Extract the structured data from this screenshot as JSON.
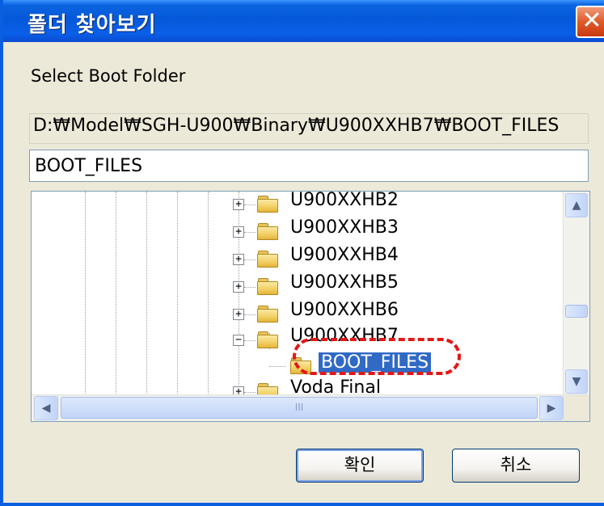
{
  "window": {
    "title": "폴더 찾아보기",
    "close_glyph": "✕"
  },
  "dialog": {
    "prompt": "Select Boot Folder",
    "current_path": "D:₩Model₩SGH-U900₩Binary₩U900XXHB7₩BOOT_FILES",
    "folder_name_value": "BOOT_FILES"
  },
  "tree": {
    "items": [
      {
        "label": "U900XXHB2",
        "expander": "+",
        "depth": 1
      },
      {
        "label": "U900XXHB3",
        "expander": "+",
        "depth": 1
      },
      {
        "label": "U900XXHB4",
        "expander": "+",
        "depth": 1
      },
      {
        "label": "U900XXHB5",
        "expander": "+",
        "depth": 1
      },
      {
        "label": "U900XXHB6",
        "expander": "+",
        "depth": 1
      },
      {
        "label": "U900XXHB7",
        "expander": "−",
        "depth": 1
      },
      {
        "label": "BOOT_FILES",
        "expander": "",
        "depth": 2,
        "selected": true
      },
      {
        "label": "Voda Final",
        "expander": "+",
        "depth": 1
      }
    ]
  },
  "scrollbars": {
    "up_glyph": "▲",
    "down_glyph": "▼",
    "left_glyph": "◀",
    "right_glyph": "▶",
    "h_grip": "III"
  },
  "buttons": {
    "ok_label": "확인",
    "cancel_label": "취소"
  },
  "colors": {
    "title_bar": "#0a5fe0",
    "selection": "#316ac5",
    "annotation": "#e21818"
  },
  "icons": [
    "close-icon",
    "folder-icon",
    "expand-icon",
    "collapse-icon"
  ]
}
